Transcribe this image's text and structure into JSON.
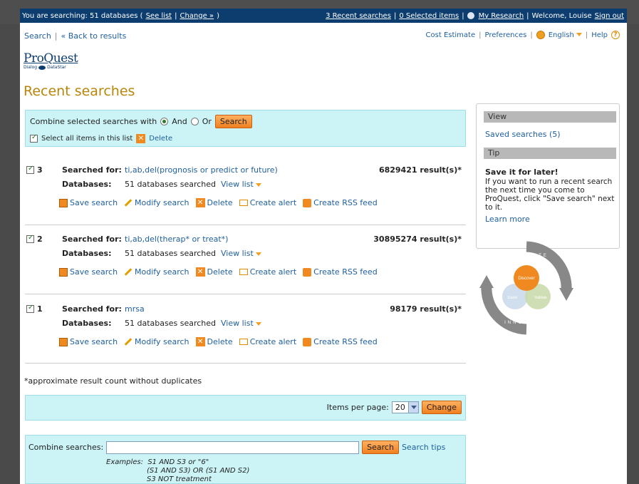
{
  "topbar": {
    "searching_prefix": "You are searching: 51 databases (",
    "see_list": "See list",
    "separator": "|",
    "change": "Change »",
    "searching_suffix": ")",
    "recent_searches": "3 Recent searches",
    "selected_items": "0 Selected items",
    "my_research": "My Research",
    "welcome": "Welcome, Louise",
    "sign_out": "Sign out"
  },
  "subnav": {
    "search": "Search",
    "separator": "|",
    "back": "« Back to results"
  },
  "utilnav": {
    "cost_estimate": "Cost Estimate",
    "preferences": "Preferences",
    "language": "English",
    "help": "Help",
    "separator": "|"
  },
  "logo": {
    "main": "ProQuest",
    "sub_left": "Dialog",
    "sub_right": "DataStar"
  },
  "page_title": "Recent searches",
  "combine": {
    "label": "Combine selected searches with",
    "and": "And",
    "or": "Or",
    "search_button": "Search",
    "select_all": "Select all items in this list",
    "delete": "Delete"
  },
  "field_labels": {
    "searched_for": "Searched for:",
    "databases": "Databases:",
    "view_list": "View list"
  },
  "actions": {
    "save": "Save search",
    "modify": "Modify search",
    "delete": "Delete",
    "alert": "Create alert",
    "rss": "Create RSS feed"
  },
  "entries": [
    {
      "number": "3",
      "query": "ti,ab,del(prognosis or predict or future)",
      "databases": "51 databases searched",
      "results": "6829421 result(s)*"
    },
    {
      "number": "2",
      "query": "ti,ab,del(therap* or treat*)",
      "databases": "51 databases searched",
      "results": "30895274 result(s)*"
    },
    {
      "number": "1",
      "query": "mrsa",
      "databases": "51 databases searched",
      "results": "98179 result(s)*"
    }
  ],
  "footnote": "*approximate result count without duplicates",
  "per_page": {
    "label": "Items per page:",
    "value": "20",
    "button": "Change"
  },
  "combine2": {
    "label": "Combine searches:",
    "search_button": "Search",
    "tips": "Search tips",
    "examples_label": "Examples:",
    "example1": "S1 AND S3 or \"6\"",
    "example2": "(S1 AND S3) OR (S1 AND S2)",
    "example3": "S3 NOT treatment"
  },
  "sidebar": {
    "view_header": "View",
    "saved_searches": "Saved searches (5)",
    "tip_header": "Tip",
    "tip_title": "Save it for later!",
    "tip_body": "If you want to run a recent search the next time you come to ProQuest, click \"Save search\" next to it.",
    "learn_more": "Learn more"
  },
  "innovate": {
    "word_top": "INNOVATE",
    "word_bottom": "INNOVATE",
    "discover": "Discover",
    "validate": "Validate",
    "Statist": "Statist"
  },
  "colors": {
    "accent_orange": "#f08a20",
    "panel_cyan": "#ccf4f6",
    "nav_blue": "#0d3d6e",
    "title_gold": "#b8860b"
  }
}
